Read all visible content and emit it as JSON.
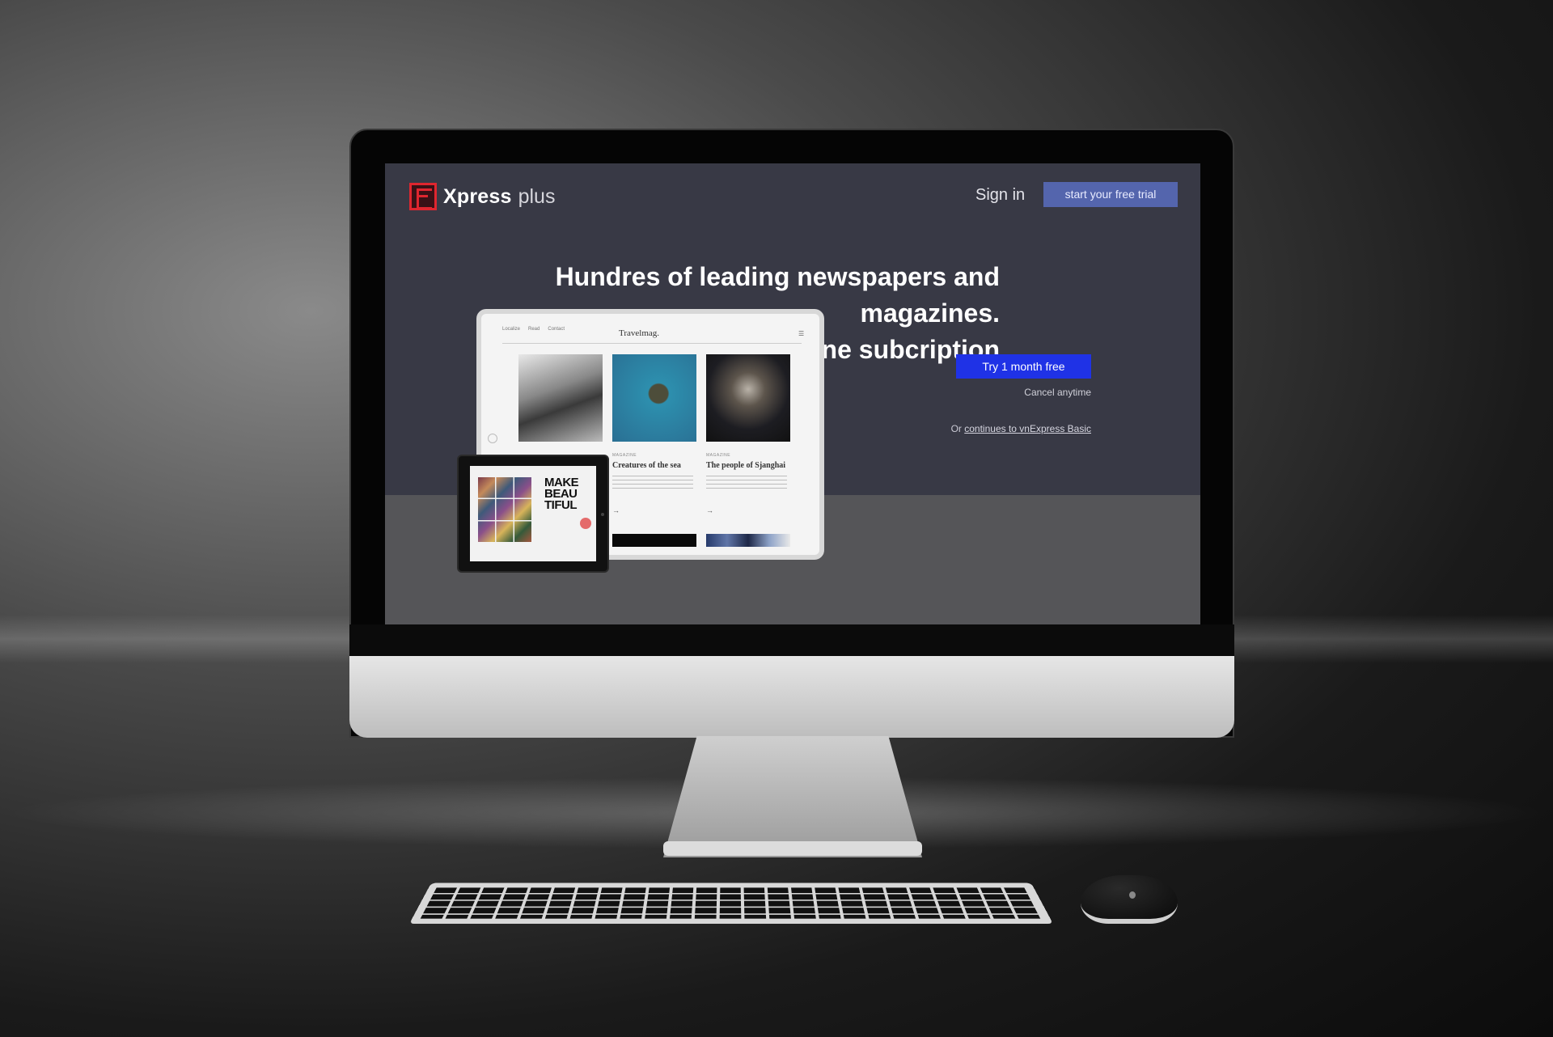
{
  "header": {
    "brand_main": "Xpress",
    "brand_sub": "plus",
    "sign_in_label": "Sign in",
    "trial_button_label": "start your free trial"
  },
  "hero": {
    "headline_line1": "Hundres of leading newspapers and magazines.",
    "headline_line2": "One subcription",
    "cta_label": "Try 1 month free",
    "cancel_note": "Cancel anytime",
    "basic_prefix": "Or ",
    "basic_link_label": "continues to vnExpress Basic"
  },
  "tablet_mockup": {
    "site_title": "Travelmag.",
    "nav_items": [
      "Localize",
      "Read",
      "Contact"
    ],
    "articles": [
      {
        "category": "MAGAZINE",
        "title": "Creatures of the sea"
      },
      {
        "category": "MAGAZINE",
        "title": "The people of Sjanghai"
      }
    ]
  },
  "ipad_mockup": {
    "cover_title": "MAKE BEAU TIFUL"
  },
  "colors": {
    "brand_red": "#e0262f",
    "hero_bg": "#383945",
    "trial_button": "#5465ad",
    "cta_button": "#1f32e6"
  },
  "icons": [
    "xpress-logo-icon",
    "menu-icon",
    "arrow-right-icon",
    "apple-logo-icon"
  ]
}
